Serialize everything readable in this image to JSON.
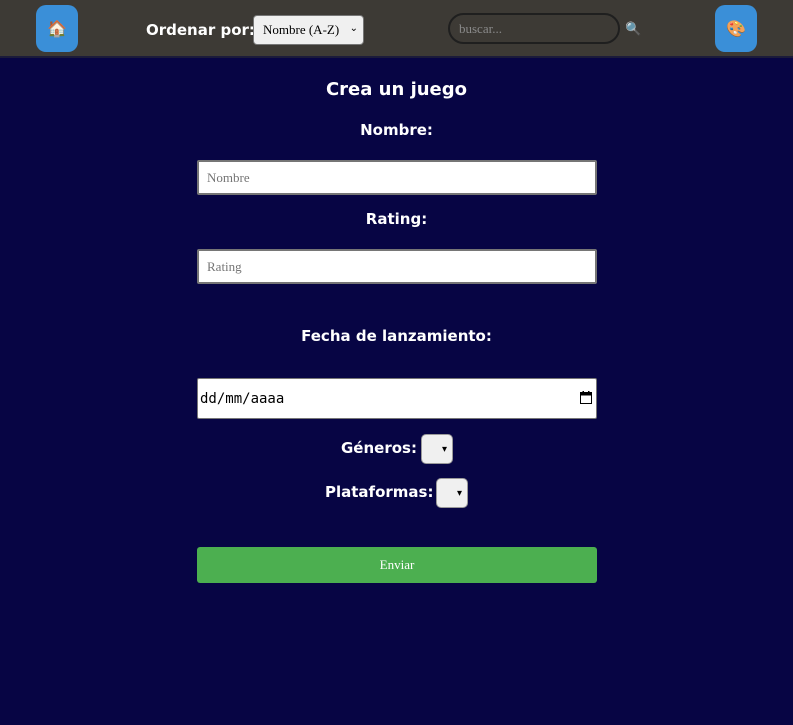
{
  "navbar": {
    "home_icon": "house-icon",
    "sort_label": "Ordenar por:",
    "sort_selected": "Nombre (A-Z)",
    "search_placeholder": "buscar...",
    "search_icon": "magnifier-icon",
    "palette_icon": "palette-icon",
    "colors": {
      "background": "#3d3a35",
      "button": "#3a8fd8"
    }
  },
  "form": {
    "title": "Crea un juego",
    "nombre_label": "Nombre:",
    "nombre_placeholder": "Nombre",
    "rating_label": "Rating:",
    "rating_placeholder": "Rating",
    "fecha_label": "Fecha de lanzamiento:",
    "fecha_value": "dd/mm/aaaa",
    "generos_label": "Géneros:",
    "plataformas_label": "Plataformas:",
    "submit_label": "Enviar",
    "colors": {
      "background": "#070544",
      "submit": "#4caf50"
    }
  }
}
